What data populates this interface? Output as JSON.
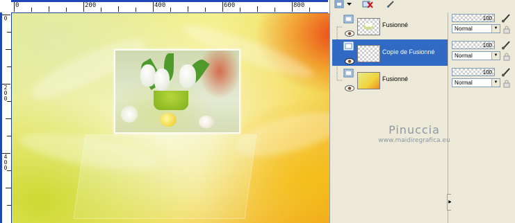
{
  "ruler": {
    "top_labels": [
      "0",
      "200",
      "400",
      "600",
      "800"
    ],
    "left_labels": [
      "0",
      "200",
      "400"
    ]
  },
  "layers": [
    {
      "name": "Fusionné",
      "selected": false,
      "thumb": "tulip-small",
      "opacity": "100",
      "blend": "Normal"
    },
    {
      "name": "Copie de Fusionné",
      "selected": true,
      "thumb": "transparent",
      "opacity": "100",
      "blend": "Normal"
    },
    {
      "name": "Fusionné",
      "selected": false,
      "thumb": "yellow-background",
      "opacity": "100",
      "blend": "Normal"
    }
  ],
  "watermark": {
    "name": "Pinuccia",
    "url": "www.maidiregrafica.eu"
  },
  "colors": {
    "selection": "#316ac5",
    "panel_bg": "#ece9d8",
    "ruler_bar": "#1f47b8",
    "watermark": "#8c97a3"
  },
  "icons": {
    "toolbar": [
      "new-layer-icon",
      "dropdown-arrow-icon",
      "delete-layer-icon",
      "edit-icon"
    ],
    "row": [
      "layer-type-icon",
      "eye-icon"
    ],
    "props": [
      "brush-icon",
      "lock-icon"
    ]
  }
}
